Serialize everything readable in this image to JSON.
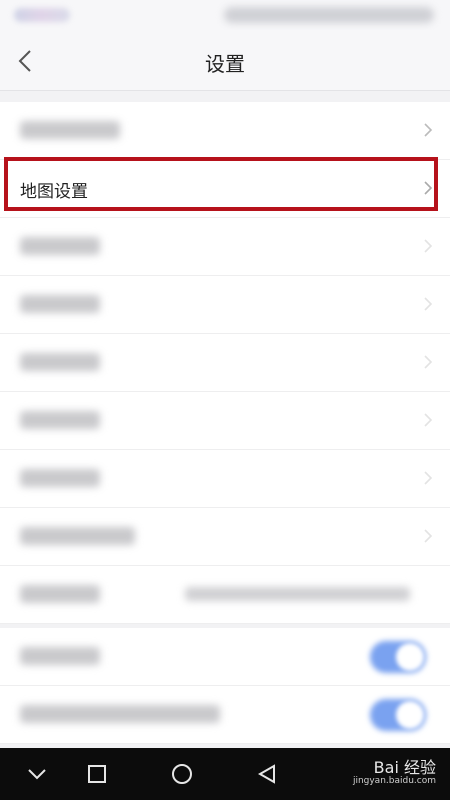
{
  "header": {
    "title": "设置"
  },
  "settings": {
    "map_settings_label": "地图设置"
  },
  "watermark": {
    "brand": "Bai 经验",
    "url": "jingyan.baidu.com"
  },
  "colors": {
    "highlight": "#b6121b",
    "toggle_on": "#7aa2f0"
  },
  "toggles": [
    {
      "state": "on"
    },
    {
      "state": "on"
    }
  ]
}
